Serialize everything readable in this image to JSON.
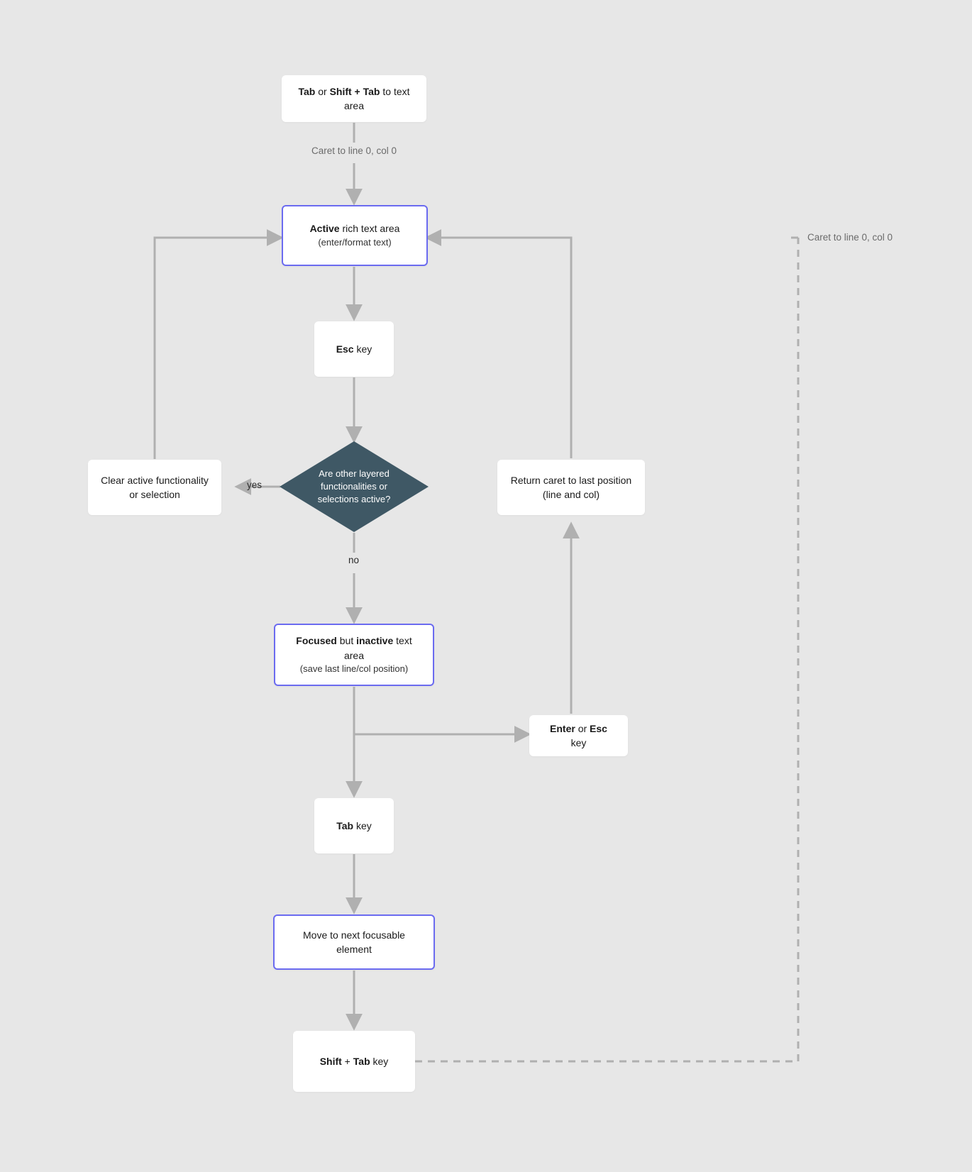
{
  "nodes": {
    "start": {
      "tab": "Tab",
      "or": " or ",
      "shift_tab": "Shift + Tab",
      "suffix": " to text area"
    },
    "active": {
      "active": "Active",
      "suffix": " rich text area",
      "sub": "(enter/format text)"
    },
    "esc": {
      "esc": "Esc",
      "suffix": " key"
    },
    "decision": {
      "text": "Are other layered functionalities or selections active?"
    },
    "clear": {
      "line1": "Clear active functionality",
      "line2": "or selection"
    },
    "return_caret": {
      "line1": "Return caret to last position",
      "line2": "(line and col)"
    },
    "focused": {
      "focused": "Focused",
      "mid": " but ",
      "inactive": "inactive",
      "suffix": " text area",
      "sub": "(save last line/col position)"
    },
    "enter_esc": {
      "enter": "Enter",
      "or": " or ",
      "esc": "Esc",
      "suffix": " key"
    },
    "tab_key": {
      "tab": "Tab",
      "suffix": " key"
    },
    "move_next": {
      "text": "Move to next focusable element"
    },
    "shift_tab_key": {
      "shift": "Shift",
      "plus": " + ",
      "tab": "Tab",
      "suffix": " key"
    }
  },
  "labels": {
    "caret_top": "Caret to line 0, col 0",
    "caret_right": "Caret to line 0, col 0",
    "yes": "yes",
    "no": "no"
  },
  "colors": {
    "highlight": "#6b6bf0",
    "diamond": "#3f5865",
    "arrow": "#b0b0b0",
    "dashed": "#b0b0b0"
  }
}
